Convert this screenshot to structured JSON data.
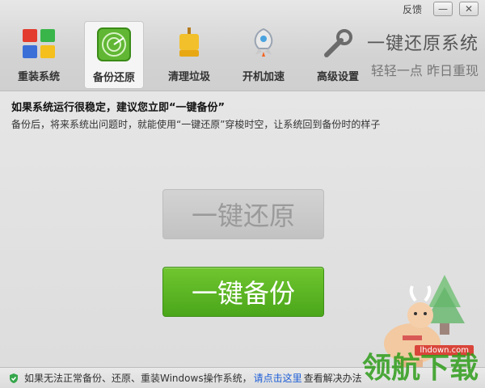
{
  "window": {
    "feedback": "反馈",
    "minimize_symbol": "—",
    "close_symbol": "✕"
  },
  "nav": {
    "items": [
      {
        "label": "重装系统",
        "icon": "windows-logo-icon"
      },
      {
        "label": "备份还原",
        "icon": "radar-icon"
      },
      {
        "label": "清理垃圾",
        "icon": "broom-icon"
      },
      {
        "label": "开机加速",
        "icon": "rocket-icon"
      },
      {
        "label": "高级设置",
        "icon": "wrench-icon"
      }
    ],
    "active_index": 1
  },
  "slogan": {
    "title": "一键还原系统",
    "subtitle": "轻轻一点 昨日重现"
  },
  "notice": {
    "bold": "如果系统运行很稳定，建议您立即“一键备份”",
    "desc": "备份后，将来系统出问题时，就能使用“一键还原”穿梭时空，让系统回到备份时的样子"
  },
  "buttons": {
    "restore": "一键还原",
    "backup": "一键备份"
  },
  "status": {
    "text": "如果无法正常备份、还原、重装Windows操作系统，",
    "link": "请点击这里",
    "suffix": "查看解决办法"
  },
  "watermark": {
    "logo_text": "领航下载",
    "site": "lhdown.com"
  },
  "colors": {
    "accent_green": "#57b01f",
    "link_blue": "#1e5fd8"
  }
}
